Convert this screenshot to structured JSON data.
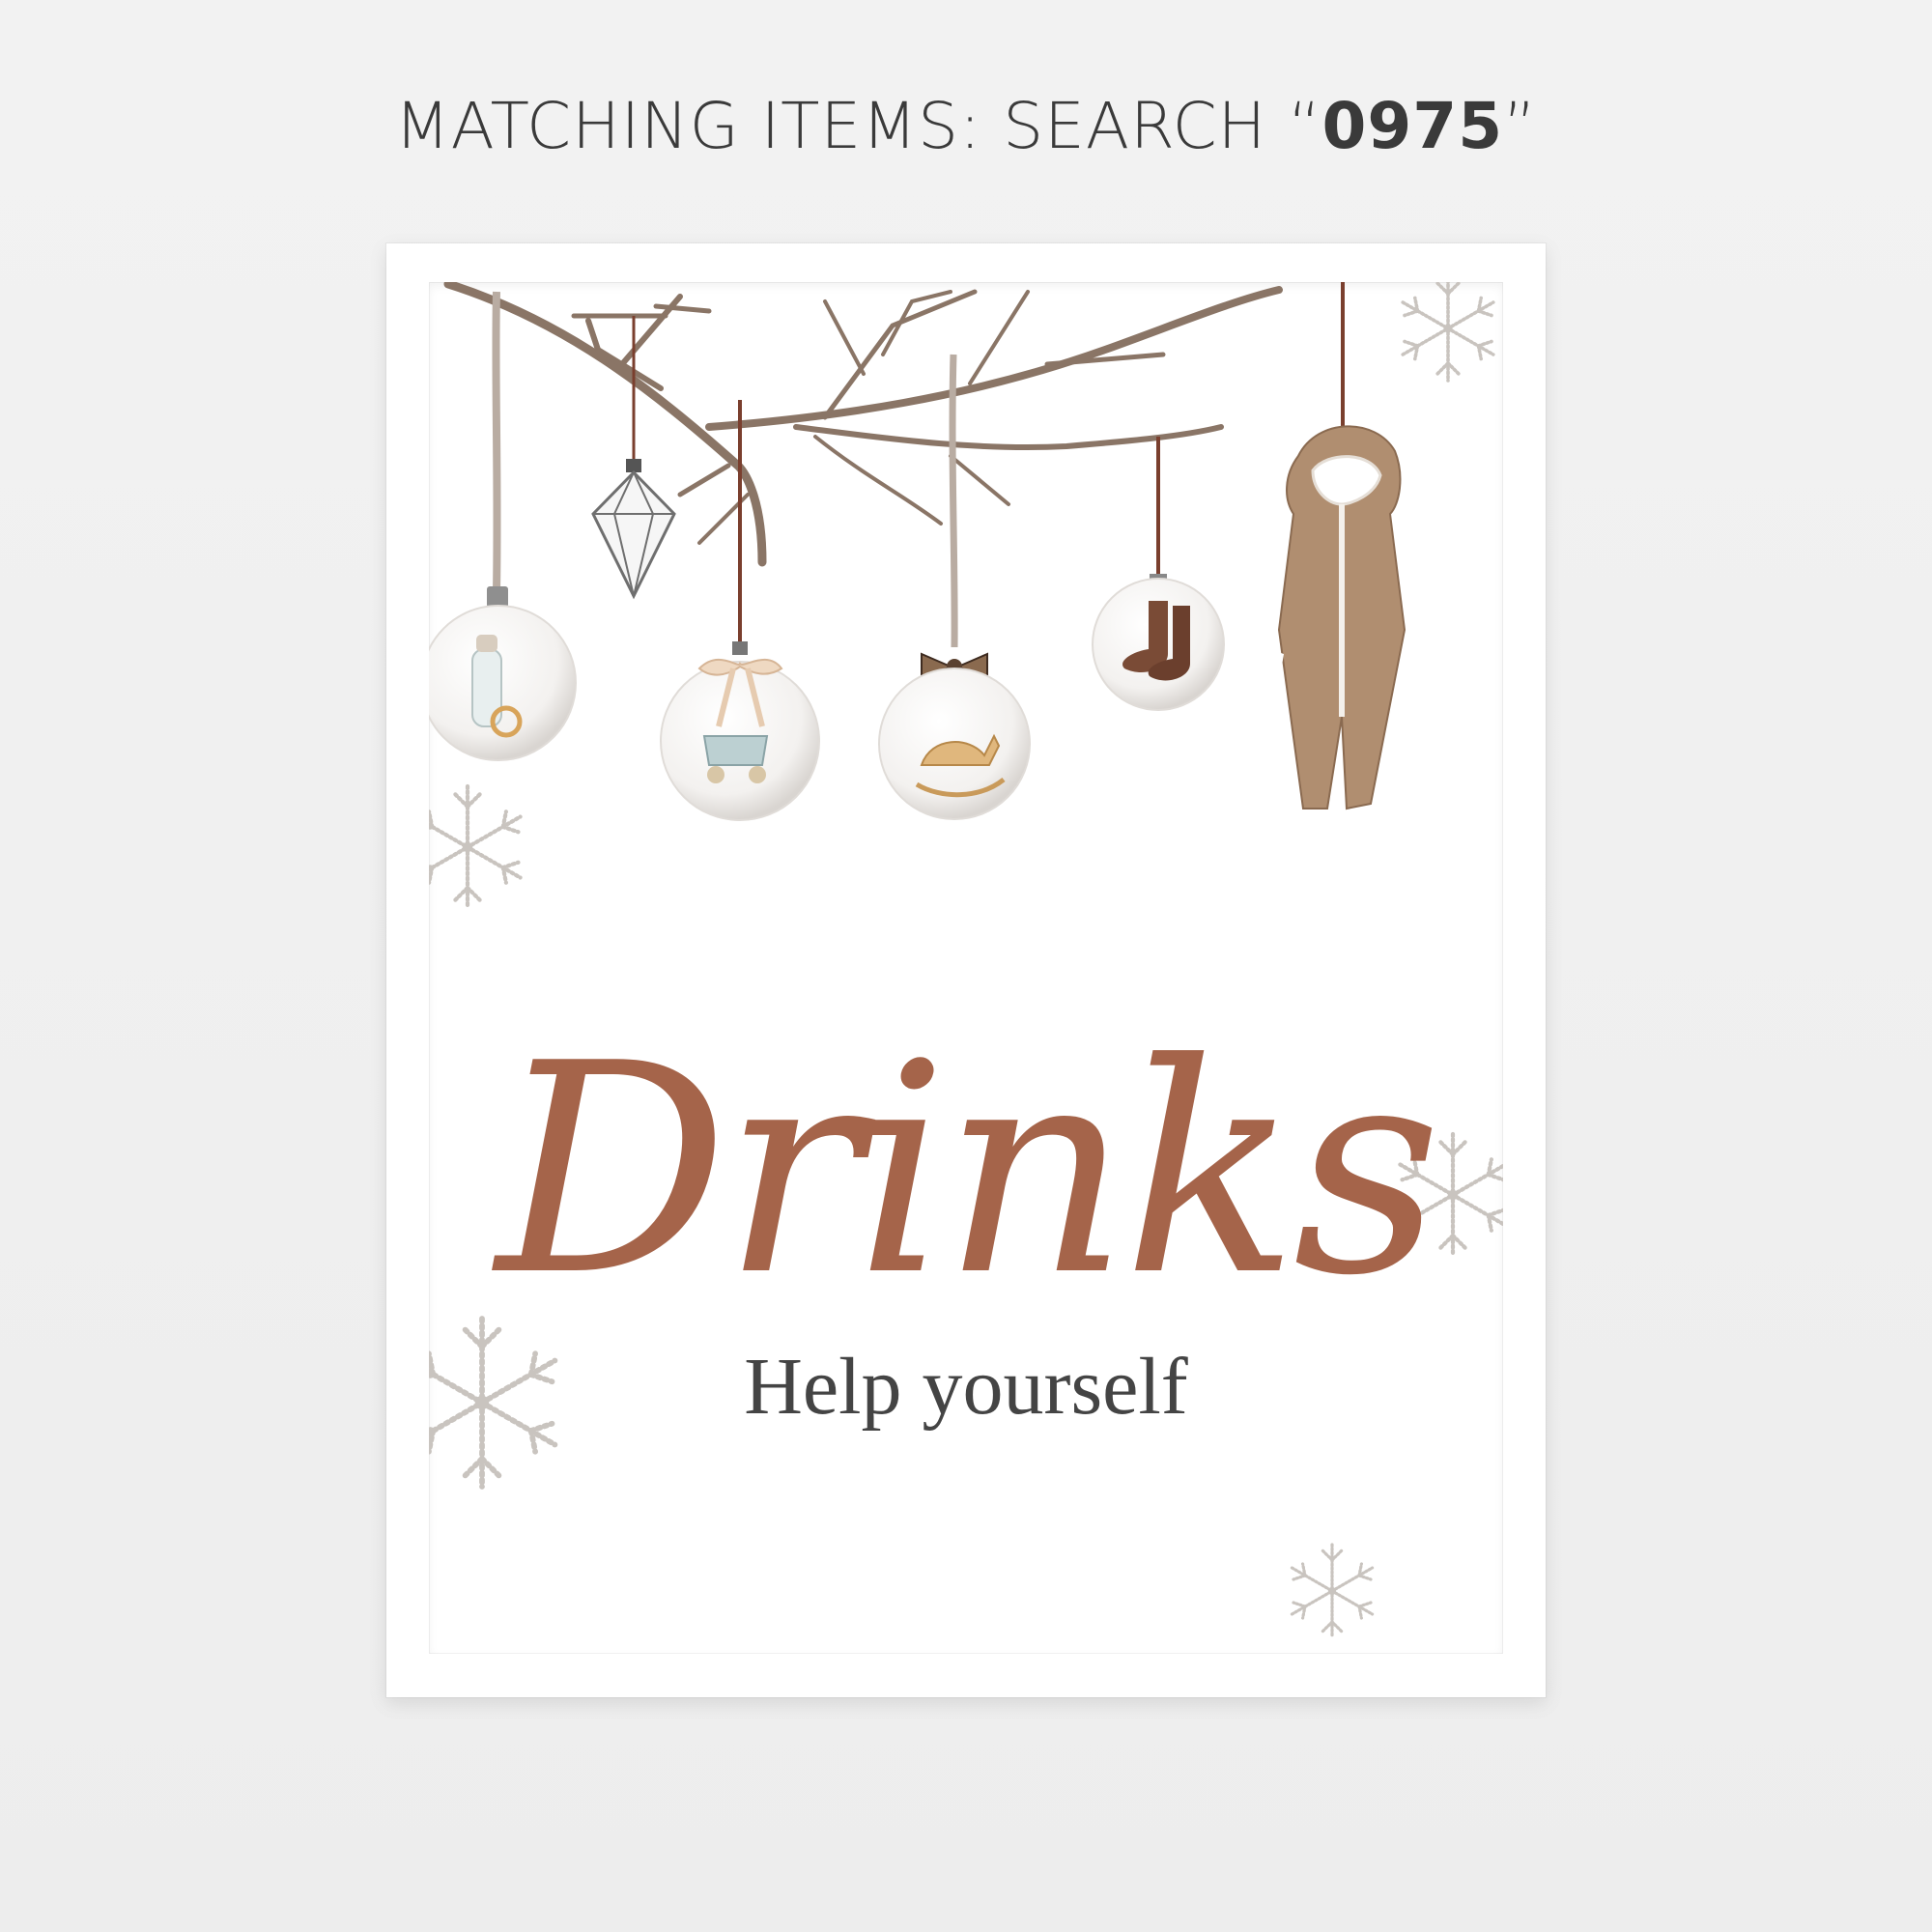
{
  "header": {
    "prefix": "MATCHING ITEMS: SEARCH “",
    "code": "0975",
    "suffix": "”"
  },
  "sign": {
    "title": "Drinks",
    "subtitle": "Help yourself"
  },
  "colors": {
    "title": "#a5644a",
    "subtitle": "#444444",
    "branch": "#8a7566",
    "ribbon": "#7a3f2e",
    "snowflake": "#c9c4bf",
    "coat": "#b08e70"
  },
  "illustration": {
    "branch": "bare-branch-icon",
    "ornaments": [
      "bottle-and-pacifier-ornament-icon",
      "geometric-lantern-ornament-icon",
      "pram-with-bow-ornament-icon",
      "rocking-horse-with-bow-ornament-icon",
      "socks-ornament-icon",
      "hooded-snowsuit-icon"
    ],
    "decorations": [
      "snowflake-icon"
    ]
  }
}
